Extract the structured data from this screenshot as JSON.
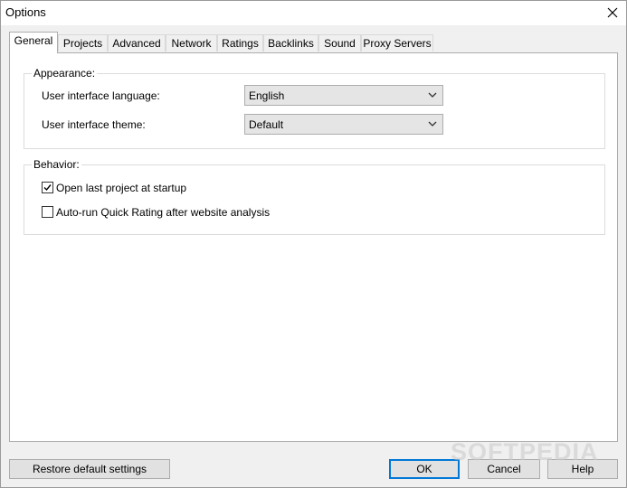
{
  "window": {
    "title": "Options"
  },
  "tabs": [
    {
      "label": "General"
    },
    {
      "label": "Projects"
    },
    {
      "label": "Advanced"
    },
    {
      "label": "Network"
    },
    {
      "label": "Ratings"
    },
    {
      "label": "Backlinks"
    },
    {
      "label": "Sound"
    },
    {
      "label": "Proxy Servers"
    }
  ],
  "appearance": {
    "legend": "Appearance:",
    "language_label": "User interface language:",
    "language_value": "English",
    "theme_label": "User interface theme:",
    "theme_value": "Default"
  },
  "behavior": {
    "legend": "Behavior:",
    "open_last_label": "Open last project at startup",
    "open_last_checked": true,
    "autorun_label": "Auto-run Quick Rating after website analysis",
    "autorun_checked": false
  },
  "buttons": {
    "restore": "Restore default settings",
    "ok": "OK",
    "cancel": "Cancel",
    "help": "Help"
  },
  "watermark": "SOFTPEDIA",
  "icons": {
    "close": "close-icon",
    "dropdown": "chevron-down-icon",
    "check": "checkmark-icon"
  },
  "colors": {
    "accent": "#0078d7",
    "panel": "#ffffff",
    "background": "#f0f0f0"
  }
}
